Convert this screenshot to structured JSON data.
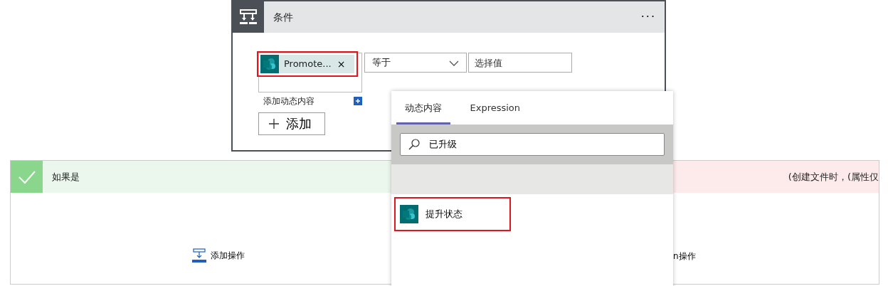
{
  "condition": {
    "title": "条件",
    "more": "···",
    "operand": {
      "label": "Promote...",
      "remove": "×",
      "highlighted": true
    },
    "operator": "等于",
    "value": {
      "placeholder": "选择值"
    },
    "add_dynamic": "添加动态内容",
    "add_button": "添加"
  },
  "if_yes": {
    "title": "如果是",
    "add_action": "添加操作"
  },
  "if_no": {
    "title": "(创建文件时，(属性仅",
    "add_action": "n操作"
  },
  "dynamic_popup": {
    "tabs": [
      {
        "label": "动态内容",
        "selected": true
      },
      {
        "label": "Expression",
        "selected": false
      }
    ],
    "search": {
      "value": "已升级"
    },
    "results": [
      {
        "label": "提升状态",
        "highlighted": true
      }
    ]
  }
}
